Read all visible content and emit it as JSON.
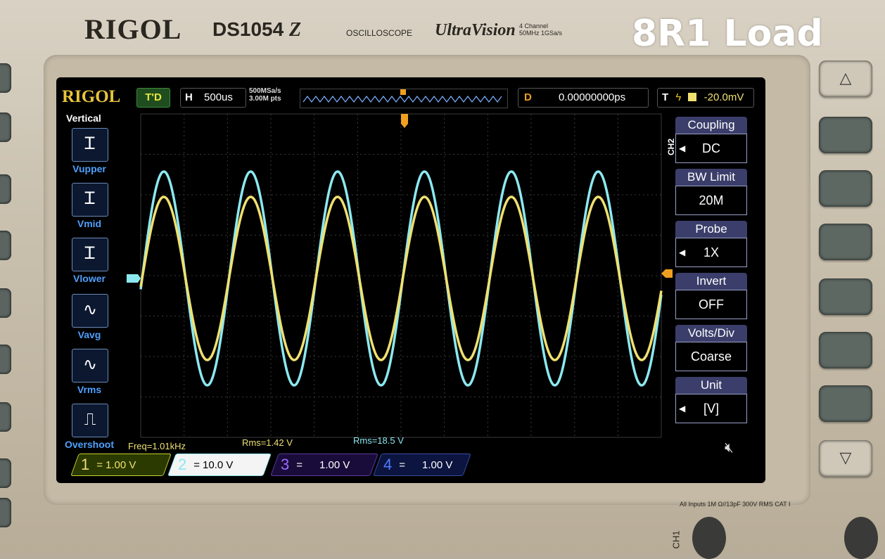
{
  "device": {
    "brand": "RIGOL",
    "model": "DS1054",
    "model_suffix": "Z",
    "product_line": "OSCILLOSCOPE",
    "series": "UltraVision",
    "spec_line1": "4 Channel",
    "spec_line2": "50MHz  1GSa/s",
    "inputs_label": "All Inputs 1M Ω//13pF 300V RMS  CAT I",
    "ch1_label": "CH1"
  },
  "overlay_label": "8R1 Load",
  "screen": {
    "logo": "RIGOL",
    "run_state": "T'D",
    "timebase_key": "H",
    "timebase_value": "500us",
    "sample_rate": "500MSa/s",
    "memory_depth": "3.00M pts",
    "delay_key": "D",
    "delay_value": "0.00000000ps",
    "trigger_key": "T",
    "trigger_edge": "ϟ",
    "trigger_level": "-20.0mV",
    "left_menu_title": "Vertical",
    "left_menu_items": [
      {
        "label": "Vupper",
        "icon": "Ꮖ"
      },
      {
        "label": "Vmid",
        "icon": "Ꮖ"
      },
      {
        "label": "Vlower",
        "icon": "Ꮖ"
      },
      {
        "label": "Vavg",
        "icon": "∿"
      },
      {
        "label": "Vrms",
        "icon": "∿"
      },
      {
        "label": "Overshoot",
        "icon": "⎍"
      }
    ],
    "measurements": {
      "freq": "Freq=1.01kHz",
      "rms_ch1": "Rms=1.42 V",
      "rms_ch2": "Rms=18.5 V"
    },
    "right_menu_channel": "CH2",
    "right_menu": [
      {
        "title": "Coupling",
        "value": "DC"
      },
      {
        "title": "BW Limit",
        "value": "20M"
      },
      {
        "title": "Probe",
        "value": "1X"
      },
      {
        "title": "Invert",
        "value": "OFF"
      },
      {
        "title": "Volts/Div",
        "value": "Coarse"
      },
      {
        "title": "Unit",
        "value": "[V]"
      }
    ],
    "channels": [
      {
        "num": "1",
        "scale": "1.00 V",
        "coupling": "="
      },
      {
        "num": "2",
        "scale": "10.0 V",
        "coupling": "="
      },
      {
        "num": "3",
        "scale": "1.00 V",
        "coupling": "="
      },
      {
        "num": "4",
        "scale": "1.00 V",
        "coupling": "="
      }
    ]
  },
  "colors": {
    "ch1": "#f0e070",
    "ch2": "#8ce8f0",
    "ch3": "#9b6cff",
    "ch4": "#4f7cff",
    "grid": "#3a3a3a"
  }
}
